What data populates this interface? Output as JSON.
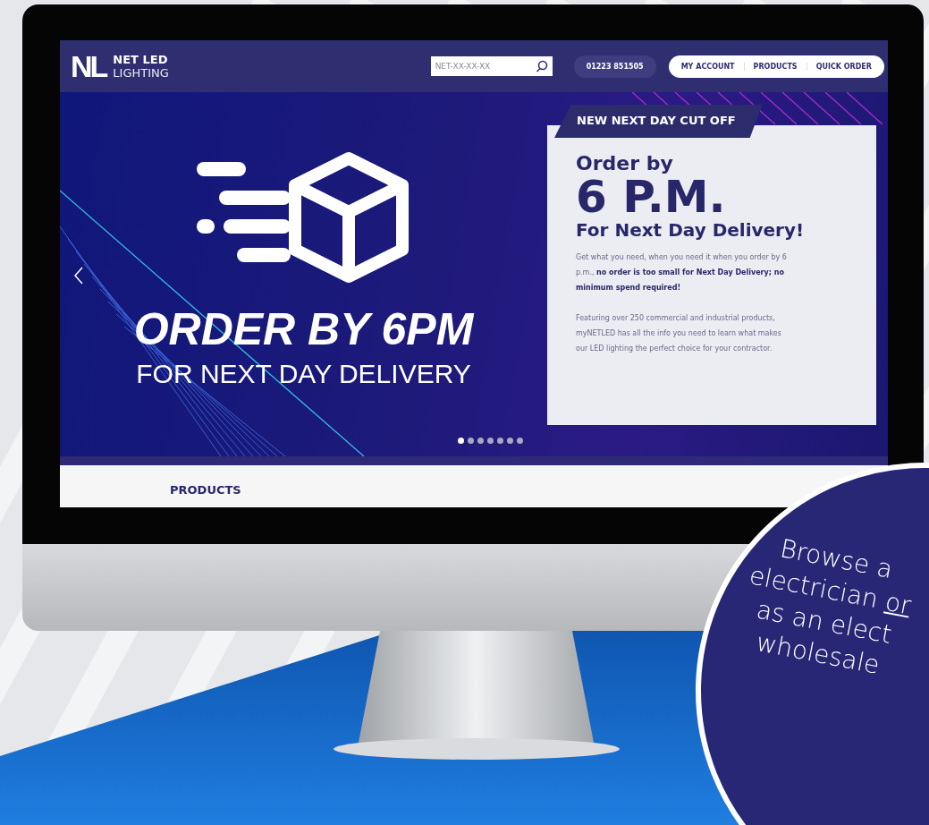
{
  "header": {
    "logo": {
      "mark": "NL",
      "name": "NET LED",
      "tagline": "LIGHTING"
    },
    "search": {
      "placeholder": "NET-XX-XX-XX"
    },
    "phone": "01223 851505",
    "nav": [
      "MY ACCOUNT",
      "PRODUCTS",
      "QUICK ORDER"
    ]
  },
  "hero": {
    "headline": "ORDER BY 6PM",
    "subline": "FOR NEXT DAY DELIVERY",
    "card": {
      "tab": "NEW NEXT DAY CUT OFF",
      "lead": "Order by",
      "time": "6 P.M.",
      "title": "For Next Day Delivery!",
      "paragraphs": [
        "Get what you need, when you need it when you order by 6 p.m., **no order is too small for Next Day Delivery; no minimum spend required!**",
        "Featuring over 250 commercial and industrial products, myNETLED has all the info you need to learn what makes our LED lighting the perfect choice for your contractor."
      ]
    },
    "slides": [
      {
        "selected": true
      },
      {
        "selected": false
      },
      {
        "selected": false
      },
      {
        "selected": false
      },
      {
        "selected": false
      },
      {
        "selected": false
      },
      {
        "selected": false
      }
    ]
  },
  "section": {
    "heading": "PRODUCTS"
  },
  "callout": {
    "lines": [
      {
        "parts": [
          {
            "text": "Browse a",
            "underlined": false
          }
        ]
      },
      {
        "parts": [
          {
            "text": "electrician ",
            "underlined": false
          },
          {
            "text": "or",
            "underlined": true
          }
        ]
      },
      {
        "parts": [
          {
            "text": "as an elect",
            "underlined": false
          }
        ]
      },
      {
        "parts": [
          {
            "text": "wholesale",
            "underlined": false
          }
        ]
      }
    ]
  }
}
